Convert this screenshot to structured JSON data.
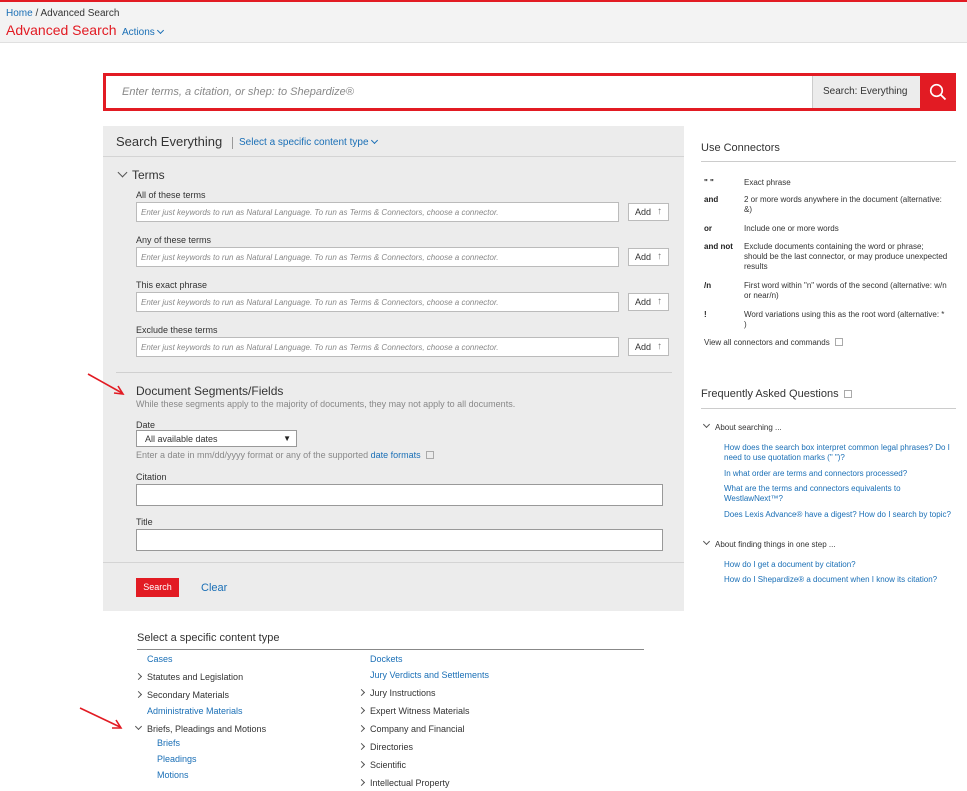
{
  "breadcrumb": {
    "home": "Home",
    "sep": " / ",
    "current": "Advanced Search"
  },
  "page_title": "Advanced Search",
  "actions_label": "Actions",
  "search": {
    "placeholder": "Enter terms, a citation, or shep: to Shepardize®",
    "scope": "Search: Everything"
  },
  "panel": {
    "title": "Search Everything",
    "content_type_link": "Select a specific content type",
    "terms_heading": "Terms",
    "fields": [
      {
        "label": "All of these terms",
        "placeholder": "Enter just keywords to run as Natural Language. To run as Terms & Connectors, choose a connector.",
        "add": "Add"
      },
      {
        "label": "Any of these terms",
        "placeholder": "Enter just keywords to run as Natural Language. To run as Terms & Connectors, choose a connector.",
        "add": "Add"
      },
      {
        "label": "This exact phrase",
        "placeholder": "Enter just keywords to run as Natural Language. To run as Terms & Connectors, choose a connector.",
        "add": "Add"
      },
      {
        "label": "Exclude these terms",
        "placeholder": "Enter just keywords to run as Natural Language. To run as Terms & Connectors, choose a connector.",
        "add": "Add"
      }
    ],
    "segments_heading": "Document Segments/Fields",
    "segments_hint": "While these segments apply to the majority of documents, they may not apply to all documents.",
    "date_label": "Date",
    "date_value": "All available dates",
    "date_hint": "Enter a date in mm/dd/yyyy format or any of the supported",
    "date_formats_link": "date formats",
    "citation_label": "Citation",
    "title_label": "Title",
    "search_button": "Search",
    "clear_button": "Clear"
  },
  "content_types": {
    "title": "Select a specific content type",
    "left": [
      "Cases",
      "Statutes and Legislation",
      "Secondary Materials",
      "Administrative Materials",
      "Briefs, Pleadings and Motions",
      "Briefs",
      "Pleadings",
      "Motions"
    ],
    "right": [
      "Dockets",
      "Jury Verdicts and Settlements",
      "Jury Instructions",
      "Expert Witness Materials",
      "Company and Financial",
      "Directories",
      "Scientific",
      "Intellectual Property"
    ]
  },
  "connectors": {
    "heading": "Use Connectors",
    "rows": [
      {
        "sym": "\" \"",
        "desc": "Exact phrase"
      },
      {
        "sym": "and",
        "desc": "2 or more words anywhere in the document (alternative: &)"
      },
      {
        "sym": "or",
        "desc": "Include one or more words"
      },
      {
        "sym": "and not",
        "desc": "Exclude documents containing the word or phrase; should be the last connector, or may produce unexpected results"
      },
      {
        "sym": "/n",
        "desc": "First word within \"n\" words of the second (alternative: w/n or near/n)"
      },
      {
        "sym": "!",
        "desc": "Word variations using this as the root word (alternative: * )"
      }
    ],
    "view_all": "View all connectors and commands"
  },
  "faq": {
    "heading": "Frequently Asked Questions",
    "group1": "About searching ...",
    "q1": [
      "How does the search box interpret common legal phrases? Do I need to use quotation marks (\" \")?",
      "In what order are terms and connectors processed?",
      "What are the terms and connectors equivalents to WestlawNext™?",
      "Does Lexis Advance® have a digest? How do I search by topic?"
    ],
    "group2": "About finding things in one step ...",
    "q2": [
      "How do I get a document by citation?",
      "How do I Shepardize® a document when I know its citation?"
    ]
  },
  "colors": {
    "accent": "#e21b23",
    "link": "#1a6fb6",
    "panel_bg": "#ececec"
  },
  "icons": [
    "search-icon",
    "chevron-down-icon",
    "chevron-right-icon",
    "add-icon",
    "external-link-icon",
    "red-arrow"
  ]
}
